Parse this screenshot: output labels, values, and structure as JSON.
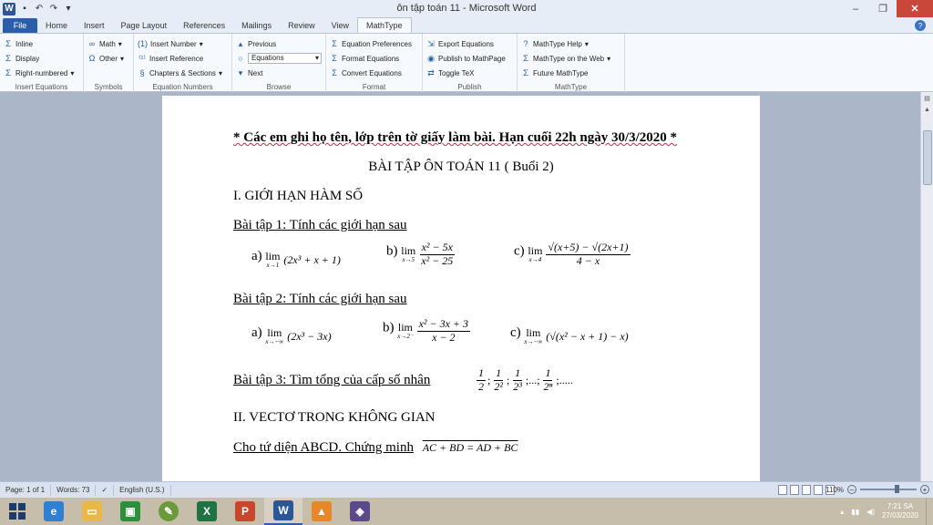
{
  "window": {
    "title": "ôn tập toán 11 - Microsoft Word",
    "minimize": "–",
    "restore": "❐",
    "close": "✕"
  },
  "tabs": [
    {
      "label": "File"
    },
    {
      "label": "Home"
    },
    {
      "label": "Insert"
    },
    {
      "label": "Page Layout"
    },
    {
      "label": "References"
    },
    {
      "label": "Mailings"
    },
    {
      "label": "Review"
    },
    {
      "label": "View"
    },
    {
      "label": "MathType"
    }
  ],
  "ribbon": {
    "insert_equations": {
      "label": "Insert Equations",
      "inline": "Inline",
      "display": "Display",
      "right_numbered": "Right-numbered"
    },
    "symbols": {
      "label": "Symbols",
      "math": "Math",
      "other": "Other"
    },
    "equation_numbers": {
      "label": "Equation Numbers",
      "insert_number": "Insert Number",
      "insert_reference": "Insert Reference",
      "chapters_sections": "Chapters & Sections"
    },
    "browse": {
      "label": "Browse",
      "previous": "Previous",
      "equations": "Equations",
      "next": "Next"
    },
    "format": {
      "label": "Format",
      "equation_preferences": "Equation Preferences",
      "format_equations": "Format Equations",
      "convert_equations": "Convert Equations"
    },
    "publish": {
      "label": "Publish",
      "export_equations": "Export Equations",
      "publish_mathpage": "Publish to MathPage",
      "toggle_tex": "Toggle TeX"
    },
    "mathtype": {
      "label": "MathType",
      "help": "MathType Help",
      "on_web": "MathType on the Web",
      "future": "Future MathType"
    }
  },
  "doc": {
    "notice": "* Các em ghi họ tên, lớp trên tờ giấy làm bài. Hạn cuối 22h ngày 30/3/2020 *",
    "title": "BÀI TẬP ÔN TOÁN 11 ( Buổi 2)",
    "section1": "I. GIỚI HẠN HÀM SỐ",
    "ex1": "Bài tập 1: Tính các giới hạn sau",
    "ex1_a": {
      "label": "a)",
      "sub": "x→1",
      "expr": "(2x³ + x + 1)"
    },
    "ex1_b": {
      "label": "b)",
      "sub": "x→5",
      "num": "x² − 5x",
      "den": "x² − 25"
    },
    "ex1_c": {
      "label": "c)",
      "sub": "x→4",
      "num": "√(x+5) − √(2x+1)",
      "den": "4 − x"
    },
    "ex2": "Bài tập 2: Tính các giới hạn sau",
    "ex2_a": {
      "label": "a)",
      "sub": "x→−∞",
      "expr": "(2x³ − 3x)"
    },
    "ex2_b": {
      "label": "b)",
      "sub": "x→2⁻",
      "num": "x² − 3x + 3",
      "den": "x − 2"
    },
    "ex2_c": {
      "label": "c)",
      "sub": "x→−∞",
      "expr": "(√(x² − x + 1) − x)"
    },
    "ex3": "Bài tập 3: Tìm tổng của cấp số nhân",
    "ex3_series": {
      "n1": "1",
      "d1": "2",
      "n2": "1",
      "d2": "2²",
      "n3": "1",
      "d3": "2³",
      "mid": ";...;",
      "n4": "1",
      "d4": "2ⁿ",
      "tail": ";....."
    },
    "section2": "II. VECTƠ TRONG KHÔNG GIAN",
    "ex4": "Cho tứ diện ABCD. Chứng minh",
    "ex4_math": "AC + BD = AD + BC"
  },
  "status": {
    "page": "Page: 1 of 1",
    "words": "Words: 73",
    "language": "English (U.S.)",
    "zoom": "110%"
  },
  "taskbar": {
    "time": "7:21 SA",
    "date": "27/03/2020"
  },
  "colors": {
    "file_tab": "#2a5ea8",
    "close": "#c9473a",
    "taskbar": "#c7bdab"
  }
}
